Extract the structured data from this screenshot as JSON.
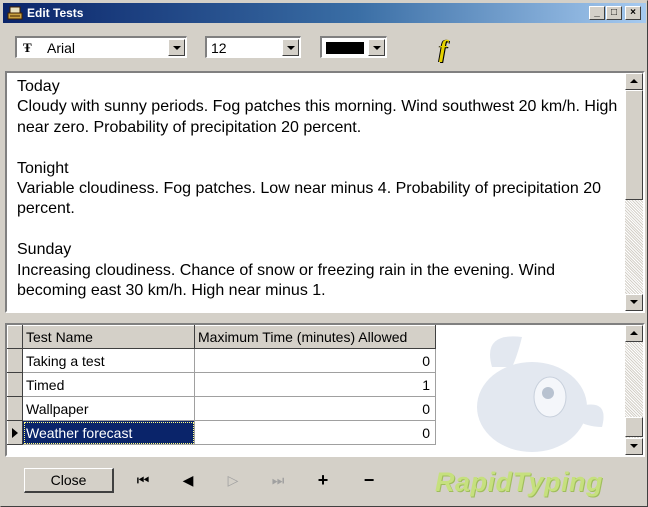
{
  "window": {
    "title": "Edit Tests",
    "controls": {
      "minimize": "_",
      "maximize": "□",
      "close": "×"
    }
  },
  "toolbar": {
    "font": "Arial",
    "font_size": "12",
    "text_color": "#000000",
    "fx_icon": "font-effects-icon"
  },
  "editor": {
    "text": "Today\nCloudy with sunny periods. Fog patches this morning. Wind southwest 20 km/h. High near zero. Probability of precipitation 20 percent.\n\nTonight\nVariable cloudiness. Fog patches. Low near minus 4. Probability of precipitation 20 percent.\n\nSunday\nIncreasing cloudiness. Chance of snow or freezing rain in the evening. Wind becoming east 30 km/h. High near minus 1."
  },
  "grid": {
    "columns": [
      "Test Name",
      "Maximum Time (minutes) Allowed"
    ],
    "rows": [
      {
        "name": "Taking a test",
        "max_time": "0",
        "selected": false
      },
      {
        "name": "Timed",
        "max_time": "1",
        "selected": false
      },
      {
        "name": "Wallpaper",
        "max_time": "0",
        "selected": false
      },
      {
        "name": "Weather forecast",
        "max_time": "0",
        "selected": true
      }
    ]
  },
  "bottombar": {
    "close_label": "Close",
    "nav": {
      "first": "⏮",
      "prev": "◀",
      "next": "▷",
      "last": "⏭",
      "add": "+",
      "delete": "−"
    },
    "brand": "RapidTyping"
  },
  "colors": {
    "title_gradient_start": "#0a246a",
    "title_gradient_end": "#a6caf0",
    "selection": "#0a246a",
    "brand": "#c6e07e"
  }
}
